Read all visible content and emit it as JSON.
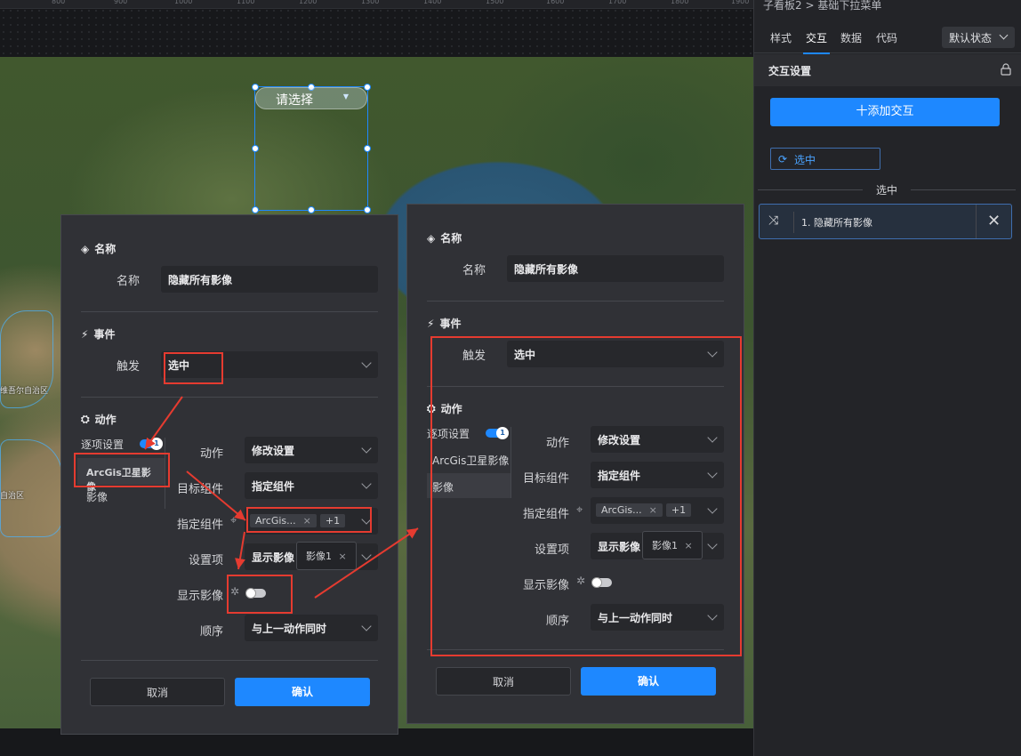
{
  "ruler": [
    "800",
    "900",
    "1000",
    "1100",
    "1200",
    "1300",
    "1400",
    "1500",
    "1600",
    "1700",
    "1800",
    "1900"
  ],
  "map": {
    "labels": [
      "维吾尔自治区",
      "自治区"
    ],
    "dropdown_placeholder": "请选择"
  },
  "dialog1": {
    "name_section": "名称",
    "name_label": "名称",
    "name_value": "隐藏所有影像",
    "event_section": "事件",
    "trigger_label": "触发",
    "trigger_value": "选中",
    "action_section": "动作",
    "list": [
      "逐项设置",
      "ArcGis卫星影像",
      "影像"
    ],
    "toggle_count": "1",
    "action_label": "动作",
    "action_value": "修改设置",
    "target_label": "目标组件",
    "target_value": "指定组件",
    "spec_label": "指定组件",
    "spec_tag": "ArcGis...",
    "spec_more": "+1",
    "tooltip": "影像1",
    "setting_label": "设置项",
    "setting_value": "显示影像",
    "show_label": "显示影像",
    "order_label": "顺序",
    "order_value": "与上一动作同时",
    "cancel": "取消",
    "confirm": "确认"
  },
  "dialog2": {
    "name_section": "名称",
    "name_label": "名称",
    "name_value": "隐藏所有影像",
    "event_section": "事件",
    "trigger_label": "触发",
    "trigger_value": "选中",
    "action_section": "动作",
    "list": [
      "逐项设置",
      "ArcGis卫星影像",
      "影像"
    ],
    "toggle_count": "1",
    "action_label": "动作",
    "action_value": "修改设置",
    "target_label": "目标组件",
    "target_value": "指定组件",
    "spec_label": "指定组件",
    "spec_tag": "ArcGis...",
    "spec_more": "+1",
    "tooltip": "影像1",
    "setting_label": "设置项",
    "setting_value": "显示影像",
    "show_label": "显示影像",
    "order_label": "顺序",
    "order_value": "与上一动作同时",
    "cancel": "取消",
    "confirm": "确认"
  },
  "panel": {
    "breadcrumb": "子看板2 > 基础下拉菜单",
    "tabs": [
      "样式",
      "交互",
      "数据",
      "代码"
    ],
    "active_tab": "交互",
    "state": "默认状态",
    "section": "交互设置",
    "add_button": "十添加交互",
    "event_chip": "选中",
    "divider": "选中",
    "action_item": "1. 隐藏所有影像"
  },
  "colors": {
    "accent": "#1e88ff",
    "annotation": "#e53b30"
  }
}
